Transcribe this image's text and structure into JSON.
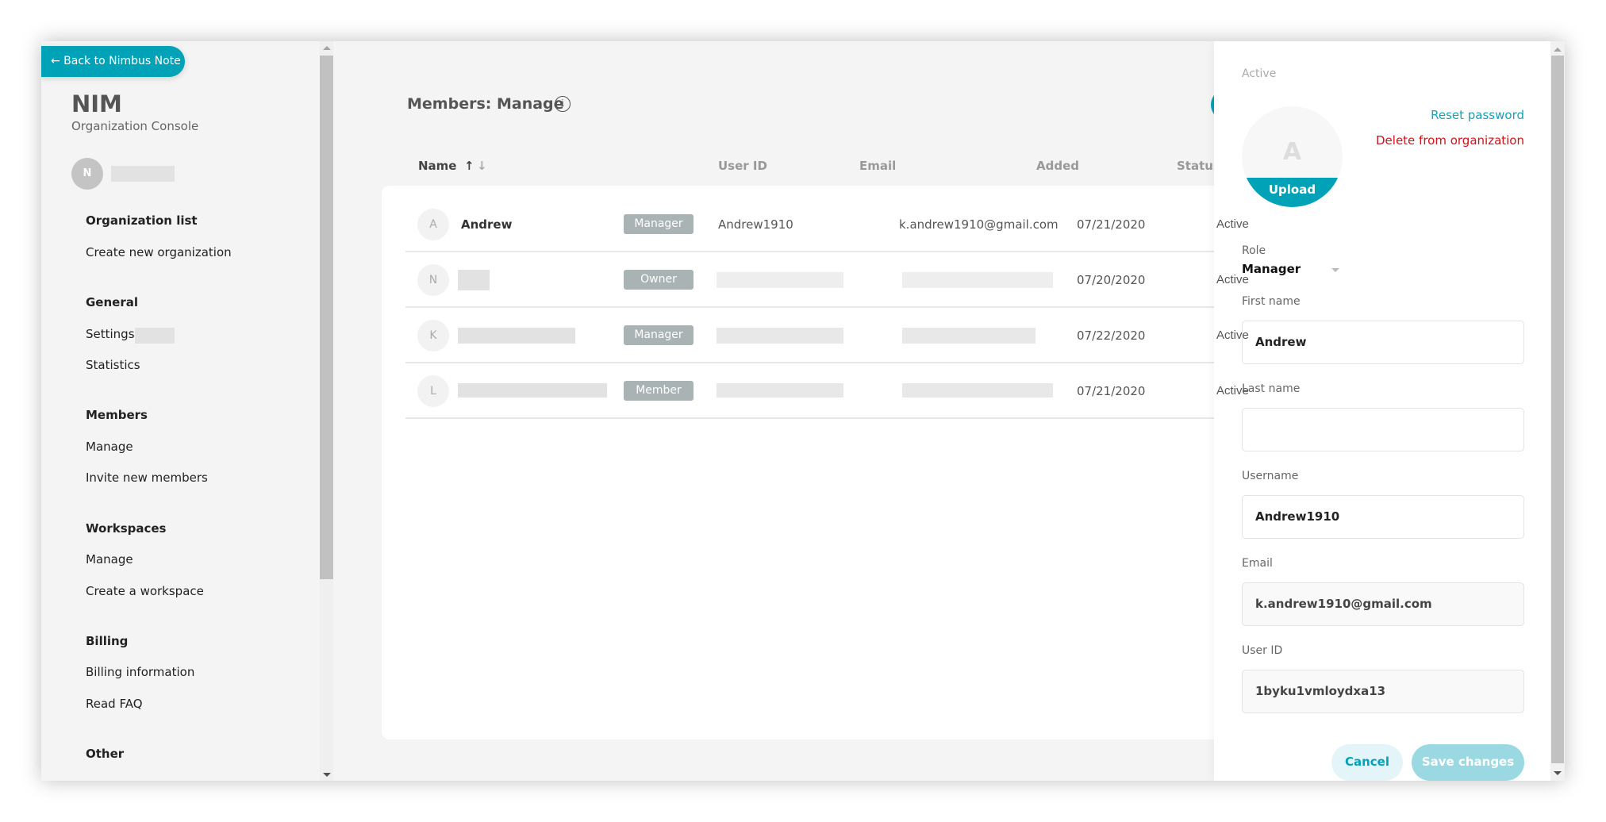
{
  "sidebar": {
    "back_label": "← Back to Nimbus Note",
    "org_name": "NIM",
    "org_subtitle": "Organization Console",
    "user_initial": "N",
    "sections": [
      {
        "title": "Organization list",
        "items": [
          "Create new organization"
        ]
      },
      {
        "title": "General",
        "items": [
          "Settings",
          "Statistics"
        ]
      },
      {
        "title": "Members",
        "items": [
          "Manage",
          "Invite new members"
        ]
      },
      {
        "title": "Workspaces",
        "items": [
          "Manage",
          "Create a workspace"
        ]
      },
      {
        "title": "Billing",
        "items": [
          "Billing information",
          "Read FAQ"
        ]
      },
      {
        "title": "Other",
        "items": []
      }
    ]
  },
  "main": {
    "title": "Members: Manage",
    "info_icon": "i",
    "columns": [
      "Name",
      "User ID",
      "Email",
      "Added",
      "Status"
    ],
    "sort_icons": [
      "↑",
      "↓"
    ],
    "rows": [
      {
        "initial": "A",
        "name": "Andrew",
        "role": "Manager",
        "user_id": "Andrew1910",
        "email": "k.andrew1910@gmail.com",
        "added": "07/21/2020",
        "status": "Active"
      },
      {
        "initial": "N",
        "name": "",
        "role": "Owner",
        "user_id": "",
        "email": "",
        "added": "07/20/2020",
        "status": "Active"
      },
      {
        "initial": "K",
        "name": "",
        "role": "Manager",
        "user_id": "",
        "email": "",
        "added": "07/22/2020",
        "status": "Active"
      },
      {
        "initial": "L",
        "name": "",
        "role": "Member",
        "user_id": "",
        "email": "",
        "added": "07/21/2020",
        "status": "Active"
      }
    ]
  },
  "panel": {
    "status": "Active",
    "avatar_initial": "A",
    "upload_label": "Upload",
    "reset_password": "Reset password",
    "delete_label": "Delete from organization",
    "role_label": "Role",
    "role_value": "Manager",
    "first_name_label": "First name",
    "first_name": "Andrew",
    "last_name_label": "Last name",
    "last_name": "",
    "username_label": "Username",
    "username": "Andrew1910",
    "email_label": "Email",
    "email": "k.andrew1910@gmail.com",
    "user_id_label": "User ID",
    "user_id": "1byku1vmloydxa13",
    "cancel_label": "Cancel",
    "save_label": "Save changes"
  },
  "colors": {
    "accent": "#00a2b8",
    "danger": "#d0121b",
    "badge": "#a9b3b3",
    "annotation_arrow": "#ee0000"
  }
}
